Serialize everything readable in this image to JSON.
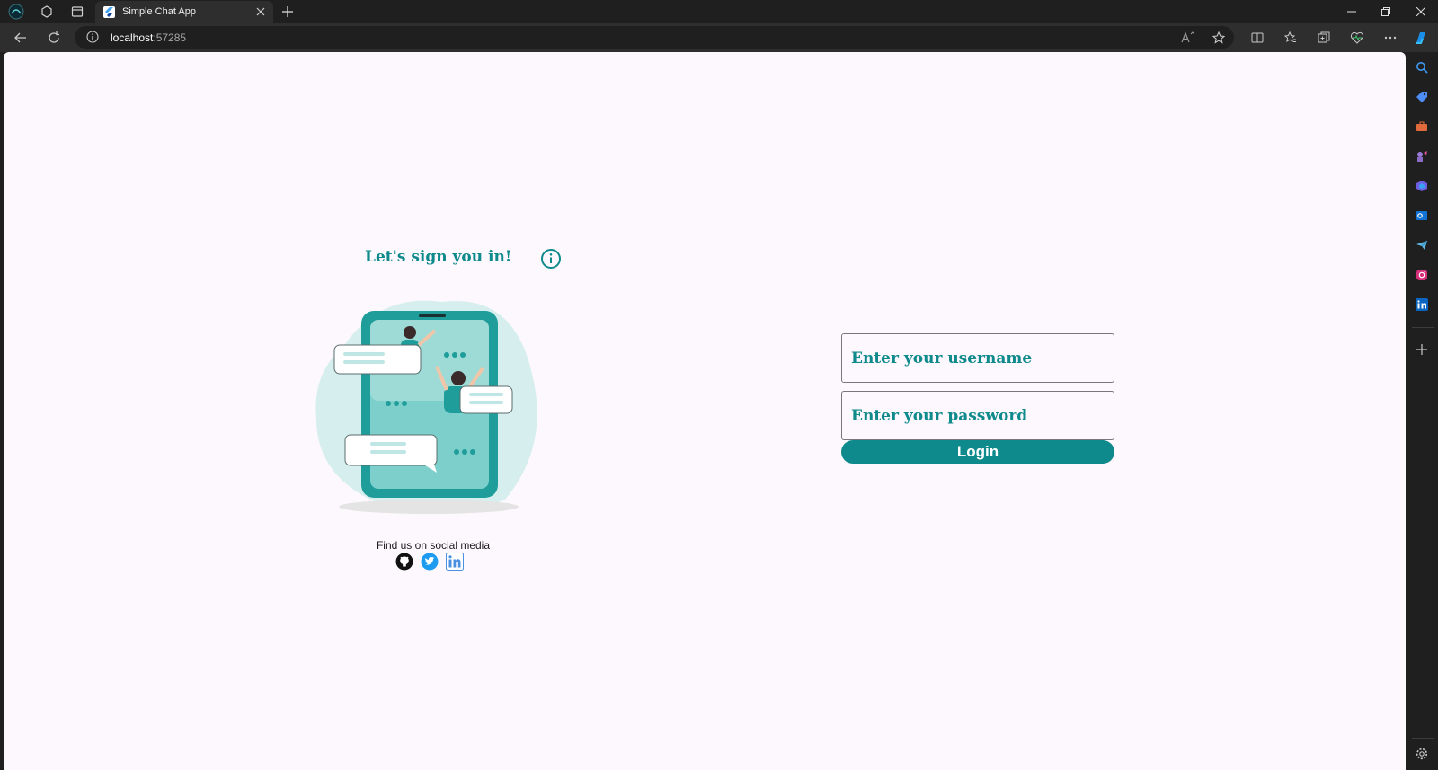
{
  "browser": {
    "tab_title": "Simple Chat App",
    "address_host": "localhost",
    "address_port": ":57285"
  },
  "page": {
    "heading": "Let's sign you in!",
    "social_label": "Find us on social media",
    "social_links": [
      "github",
      "twitter",
      "linkedin"
    ],
    "username_placeholder": "Enter your username",
    "password_placeholder": "Enter your password",
    "login_label": "Login"
  },
  "colors": {
    "accent": "#0e8a8c",
    "page_background": "#fdf8fd",
    "browser_chrome": "#2e2e2e"
  }
}
